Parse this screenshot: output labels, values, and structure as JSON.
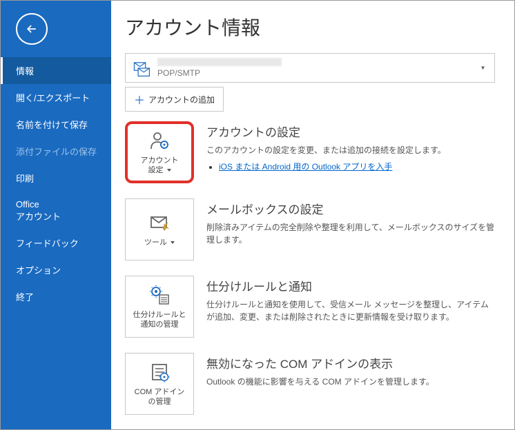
{
  "sidebar": {
    "items": [
      {
        "label": "情報",
        "active": true
      },
      {
        "label": "開く/エクスポート"
      },
      {
        "label": "名前を付けて保存"
      },
      {
        "label": "添付ファイルの保存",
        "disabled": true
      },
      {
        "label": "印刷"
      },
      {
        "label": "Office\nアカウント",
        "multiline": true
      },
      {
        "label": "フィードバック"
      },
      {
        "label": "オプション"
      },
      {
        "label": "終了"
      }
    ]
  },
  "page": {
    "title": "アカウント情報"
  },
  "account": {
    "protocol": "POP/SMTP",
    "add_button": "アカウントの追加"
  },
  "sections": [
    {
      "button_label": "アカウント\n設定",
      "has_dropdown": true,
      "highlighted": true,
      "title": "アカウントの設定",
      "desc": "このアカウントの設定を変更、または追加の接続を設定します。",
      "link": "iOS または Android 用の Outlook アプリを入手"
    },
    {
      "button_label": "ツール",
      "has_dropdown": true,
      "title": "メールボックスの設定",
      "desc": "削除済みアイテムの完全削除や整理を利用して、メールボックスのサイズを管理します。"
    },
    {
      "button_label": "仕分けルールと\n通知の管理",
      "title": "仕分けルールと通知",
      "desc": "仕分けルールと通知を使用して、受信メール メッセージを整理し、アイテムが追加、変更、または削除されたときに更新情報を受け取ります。"
    },
    {
      "button_label": "COM アドイン\nの管理",
      "title": "無効になった COM アドインの表示",
      "desc": "Outlook の機能に影響を与える COM アドインを管理します。"
    }
  ]
}
